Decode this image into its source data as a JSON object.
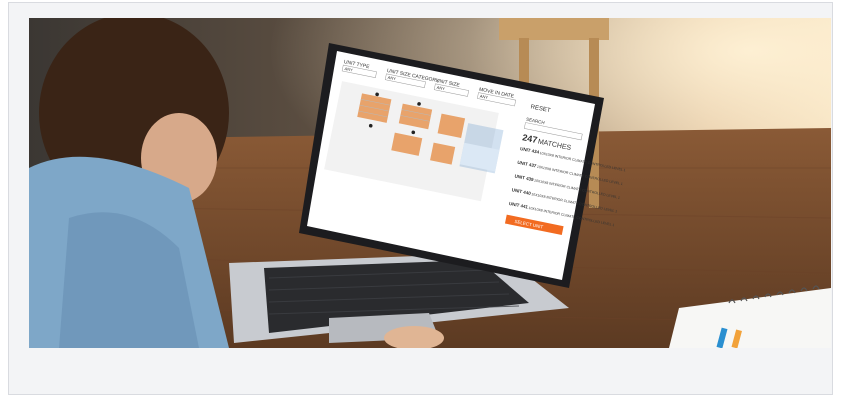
{
  "image": {
    "alt": "Woman using a laptop showing a storage unit facility map and unit listing"
  },
  "screen": {
    "filters": [
      {
        "label": "UNIT TYPE",
        "value": "ANY"
      },
      {
        "label": "UNIT SIZE CATEGORY",
        "value": "ANY"
      },
      {
        "label": "UNIT SIZE",
        "value": "ANY"
      },
      {
        "label": "MOVE IN DATE",
        "value": "ANY"
      }
    ],
    "reset_label": "RESET",
    "search_label": "SEARCH",
    "matches_count": "247",
    "matches_label": "MATCHES",
    "units": [
      {
        "title": "UNIT 434",
        "desc": "10X10X8 INTERIOR CLIMATE CONTROLLED LEVEL 1"
      },
      {
        "title": "UNIT 437",
        "desc": "10X10X8 INTERIOR CLIMATE CONTROLLED LEVEL 1"
      },
      {
        "title": "UNIT 439",
        "desc": "10X10X8 INTERIOR CLIMATE CONTROLLED LEVEL 1"
      },
      {
        "title": "UNIT 440",
        "desc": "10X10X8 INTERIOR CLIMATE CONTROLLED LEVEL 1"
      },
      {
        "title": "UNIT 441",
        "desc": "10X10X8 INTERIOR CLIMATE CONTROLLED LEVEL 1"
      }
    ],
    "cta_label": "SELECT UNIT"
  },
  "colors": {
    "accent_orange": "#f26b21",
    "map_orange": "#e8a36b",
    "popup_blue": "#4a86c5"
  }
}
